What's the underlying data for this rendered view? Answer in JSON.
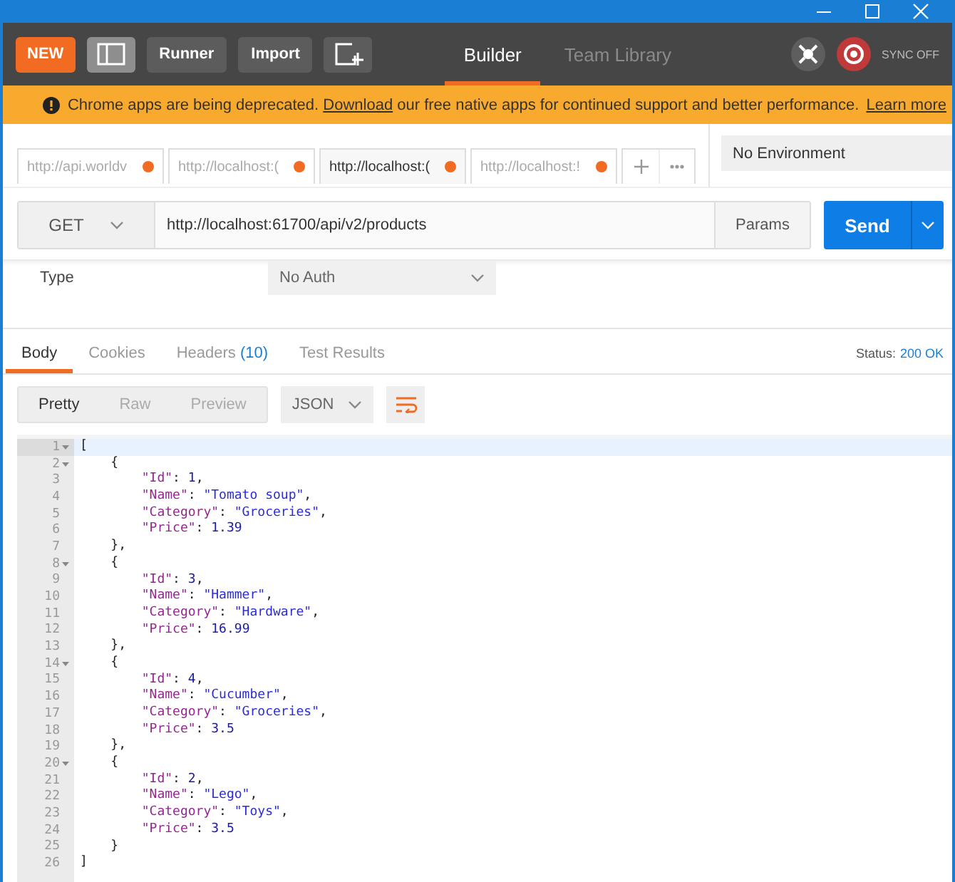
{
  "header": {
    "buttons": [
      {
        "kind": "new",
        "label": "NEW"
      },
      {
        "kind": "sidebar-toggle"
      },
      {
        "kind": "text",
        "label": "Runner"
      },
      {
        "kind": "text",
        "label": "Import"
      },
      {
        "kind": "new-window"
      }
    ],
    "tabs": [
      {
        "label": "Builder",
        "selected": true
      },
      {
        "label": "Team Library",
        "selected": false
      }
    ],
    "sync": "SYNC OFF"
  },
  "banner": {
    "text_before": "Chrome apps are being deprecated.",
    "link": "Download",
    "text_after": "our free native apps for continued support and better performance.",
    "learn_more": "Learn more"
  },
  "request_tabs": [
    {
      "label": "http://api.worldv",
      "selected": false,
      "unsaved": true
    },
    {
      "label": "http://localhost:(",
      "selected": false,
      "unsaved": true
    },
    {
      "label": "http://localhost:(",
      "selected": true,
      "unsaved": true
    },
    {
      "label": "http://localhost:!",
      "selected": false,
      "unsaved": true
    }
  ],
  "environment": "No Environment",
  "request": {
    "method": "GET",
    "url": "http://localhost:61700/api/v2/products",
    "params": "Params",
    "send": "Send"
  },
  "auth": {
    "label": "Type",
    "value": "No Auth"
  },
  "response_tabs": [
    {
      "label": "Body",
      "selected": true
    },
    {
      "label": "Cookies",
      "selected": false
    },
    {
      "label": "Headers",
      "count": "(10)",
      "selected": false
    },
    {
      "label": "Test Results",
      "selected": false
    }
  ],
  "status": {
    "label": "Status:",
    "value": "200 OK"
  },
  "view_modes": [
    {
      "label": "Pretty",
      "selected": true
    },
    {
      "label": "Raw",
      "selected": false
    },
    {
      "label": "Preview",
      "selected": false
    }
  ],
  "format": "JSON",
  "code_lines": [
    {
      "number": "1",
      "foldable": true,
      "active": true,
      "text": "["
    },
    {
      "number": "2",
      "foldable": true,
      "active": false,
      "text": "    {"
    },
    {
      "number": "3",
      "foldable": false,
      "active": false,
      "text": "        \"Id\": 1,"
    },
    {
      "number": "4",
      "foldable": false,
      "active": false,
      "text": "        \"Name\": \"Tomato soup\","
    },
    {
      "number": "5",
      "foldable": false,
      "active": false,
      "text": "        \"Category\": \"Groceries\","
    },
    {
      "number": "6",
      "foldable": false,
      "active": false,
      "text": "        \"Price\": 1.39"
    },
    {
      "number": "7",
      "foldable": false,
      "active": false,
      "text": "    },"
    },
    {
      "number": "8",
      "foldable": true,
      "active": false,
      "text": "    {"
    },
    {
      "number": "9",
      "foldable": false,
      "active": false,
      "text": "        \"Id\": 3,"
    },
    {
      "number": "10",
      "foldable": false,
      "active": false,
      "text": "        \"Name\": \"Hammer\","
    },
    {
      "number": "11",
      "foldable": false,
      "active": false,
      "text": "        \"Category\": \"Hardware\","
    },
    {
      "number": "12",
      "foldable": false,
      "active": false,
      "text": "        \"Price\": 16.99"
    },
    {
      "number": "13",
      "foldable": false,
      "active": false,
      "text": "    },"
    },
    {
      "number": "14",
      "foldable": true,
      "active": false,
      "text": "    {"
    },
    {
      "number": "15",
      "foldable": false,
      "active": false,
      "text": "        \"Id\": 4,"
    },
    {
      "number": "16",
      "foldable": false,
      "active": false,
      "text": "        \"Name\": \"Cucumber\","
    },
    {
      "number": "17",
      "foldable": false,
      "active": false,
      "text": "        \"Category\": \"Groceries\","
    },
    {
      "number": "18",
      "foldable": false,
      "active": false,
      "text": "        \"Price\": 3.5"
    },
    {
      "number": "19",
      "foldable": false,
      "active": false,
      "text": "    },"
    },
    {
      "number": "20",
      "foldable": true,
      "active": false,
      "text": "    {"
    },
    {
      "number": "21",
      "foldable": false,
      "active": false,
      "text": "        \"Id\": 2,"
    },
    {
      "number": "22",
      "foldable": false,
      "active": false,
      "text": "        \"Name\": \"Lego\","
    },
    {
      "number": "23",
      "foldable": false,
      "active": false,
      "text": "        \"Category\": \"Toys\","
    },
    {
      "number": "24",
      "foldable": false,
      "active": false,
      "text": "        \"Price\": 3.5"
    },
    {
      "number": "25",
      "foldable": false,
      "active": false,
      "text": "    }"
    },
    {
      "number": "26",
      "foldable": false,
      "active": false,
      "text": "]"
    }
  ]
}
